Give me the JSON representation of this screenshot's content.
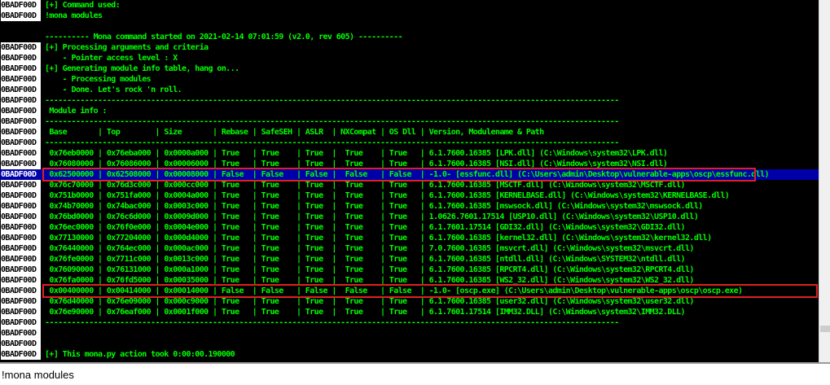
{
  "log": {
    "lines": [
      {
        "address": "0BADF00D",
        "text": "[+] Command used:"
      },
      {
        "address": "0BADF00D",
        "text": "!mona modules"
      },
      {
        "address": "",
        "text": ""
      },
      {
        "address": "",
        "text": "---------- Mona command started on 2021-02-14 07:01:59 (v2.0, rev 605) ----------"
      },
      {
        "address": "0BADF00D",
        "text": "[+] Processing arguments and criteria"
      },
      {
        "address": "0BADF00D",
        "text": "    - Pointer access level : X"
      },
      {
        "address": "0BADF00D",
        "text": "[+] Generating module info table, hang on..."
      },
      {
        "address": "0BADF00D",
        "text": "    - Processing modules"
      },
      {
        "address": "0BADF00D",
        "text": "    - Done. Let's rock 'n roll."
      },
      {
        "address": "0BADF00D",
        "text": "----------------------------------------------------------------------------------------------------------------------------------"
      },
      {
        "address": "0BADF00D",
        "text": " Module info :"
      },
      {
        "address": "0BADF00D",
        "text": "----------------------------------------------------------------------------------------------------------------------------------"
      },
      {
        "address": "0BADF00D",
        "text": " Base       | Top        | Size       | Rebase | SafeSEH | ASLR  | NXCompat | OS Dll | Version, Modulename & Path"
      },
      {
        "address": "0BADF00D",
        "text": "----------------------------------------------------------------------------------------------------------------------------------"
      },
      {
        "address": "0BADF00D",
        "text": " 0x76eb0000 | 0x76eba000 | 0x0000a000 | True   | True    | True  |  True    | True   | 6.1.7600.16385 [LPK.dll] (C:\\Windows\\system32\\LPK.dll)"
      },
      {
        "address": "0BADF00D",
        "text": " 0x76080000 | 0x76086000 | 0x00006000 | True   | True    | True  |  True    | True   | 6.1.7600.16385 [NSI.dll] (C:\\Windows\\system32\\NSI.dll)"
      },
      {
        "address": "0BADF00D",
        "text": " 0x62500000 | 0x62508000 | 0x00008000 | False  | False   | False |  False   | False  | -1.0- [essfunc.dll] (C:\\Users\\admin\\Desktop\\vulnerable-apps\\oscp\\essfunc.dll)",
        "selected": true
      },
      {
        "address": "0BADF00D",
        "text": " 0x76c70000 | 0x76d3c000 | 0x000cc000 | True   | True    | True  |  True    | True   | 6.1.7600.16385 [MSCTF.dll] (C:\\Windows\\system32\\MSCTF.dll)"
      },
      {
        "address": "0BADF00D",
        "text": " 0x751b0000 | 0x751fa000 | 0x0004a000 | True   | True    | True  |  True    | True   | 6.1.7600.16385 [KERNELBASE.dll] (C:\\Windows\\system32\\KERNELBASE.dll)"
      },
      {
        "address": "0BADF00D",
        "text": " 0x74b70000 | 0x74bac000 | 0x0003c000 | True   | True    | True  |  True    | True   | 6.1.7600.16385 [mswsock.dll] (C:\\Windows\\system32\\mswsock.dll)"
      },
      {
        "address": "0BADF00D",
        "text": " 0x76bd0000 | 0x76c6d000 | 0x0009d000 | True   | True    | True  |  True    | True   | 1.0626.7601.17514 [USP10.dll] (C:\\Windows\\system32\\USP10.dll)"
      },
      {
        "address": "0BADF00D",
        "text": " 0x76ec0000 | 0x76f0e000 | 0x0004e000 | True   | True    | True  |  True    | True   | 6.1.7601.17514 [GDI32.dll] (C:\\Windows\\system32\\GDI32.dll)"
      },
      {
        "address": "0BADF00D",
        "text": " 0x77130000 | 0x77204000 | 0x000d4000 | True   | True    | True  |  True    | True   | 6.1.7600.16385 [kernel32.dll] (C:\\Windows\\system32\\kernel32.dll)"
      },
      {
        "address": "0BADF00D",
        "text": " 0x76440000 | 0x764ec000 | 0x000ac000 | True   | True    | True  |  True    | True   | 7.0.7600.16385 [msvcrt.dll] (C:\\Windows\\system32\\msvcrt.dll)"
      },
      {
        "address": "0BADF00D",
        "text": " 0x76fe0000 | 0x7711c000 | 0x0013c000 | True   | True    | True  |  True    | True   | 6.1.7600.16385 [ntdll.dll] (C:\\Windows\\SYSTEM32\\ntdll.dll)"
      },
      {
        "address": "0BADF00D",
        "text": " 0x76090000 | 0x76131000 | 0x000a1000 | True   | True    | True  |  True    | True   | 6.1.7600.16385 [RPCRT4.dll] (C:\\Windows\\system32\\RPCRT4.dll)"
      },
      {
        "address": "0BADF00D",
        "text": " 0x76fa0000 | 0x76fd5000 | 0x00035000 | True   | True    | True  |  True    | True   | 6.1.7600.16385 [WS2_32.dll] (C:\\Windows\\system32\\WS2_32.dll)"
      },
      {
        "address": "0BADF00D",
        "text": " 0x00400000 | 0x00414000 | 0x00014000 | False  | False   | False |  False   | False  | -1.0- [oscp.exe] (C:\\Users\\admin\\Desktop\\vulnerable-apps\\oscp\\oscp.exe)"
      },
      {
        "address": "0BADF00D",
        "text": " 0x76d40000 | 0x76e09000 | 0x000c9000 | True   | True    | True  |  True    | True   | 6.1.7600.16385 [user32.dll] (C:\\Windows\\system32\\user32.dll)"
      },
      {
        "address": "0BADF00D",
        "text": " 0x76e90000 | 0x76eaf000 | 0x0001f000 | True   | True    | True  |  True    | True   | 6.1.7601.17514 [IMM32.DLL] (C:\\Windows\\system32\\IMM32.DLL)"
      },
      {
        "address": "0BADF00D",
        "text": "----------------------------------------------------------------------------------------------------------------------------------"
      },
      {
        "address": "0BADF00D",
        "text": ""
      },
      {
        "address": "0BADF00D",
        "text": ""
      },
      {
        "address": "0BADF00D",
        "text": "[+] This mona.py action took 0:00:00.190000"
      }
    ]
  },
  "command_bar": {
    "value": "!mona modules"
  },
  "colors": {
    "background": "#000000",
    "text": "#00ff00",
    "address_bg": "#ffffff",
    "selection": "#0000a8",
    "annotation": "#e02020"
  }
}
